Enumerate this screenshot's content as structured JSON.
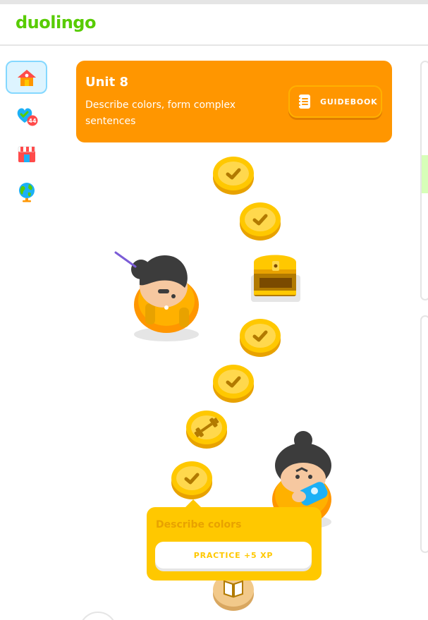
{
  "app": {
    "logo_text": "duolingo"
  },
  "sidebar": {
    "items": [
      {
        "name": "learn",
        "icon": "home-icon",
        "active": true
      },
      {
        "name": "practice",
        "icon": "practice-hub-icon",
        "badge": "44"
      },
      {
        "name": "shop",
        "icon": "shop-icon"
      },
      {
        "name": "profile",
        "icon": "globe-icon"
      }
    ]
  },
  "unit": {
    "title": "Unit 8",
    "description": "Describe colors, form complex sentences",
    "guidebook_label": "GUIDEBOOK",
    "color": "#ff9600"
  },
  "path": {
    "nodes": [
      {
        "type": "completed-lesson",
        "icon": "check-icon"
      },
      {
        "type": "completed-lesson",
        "icon": "check-icon"
      },
      {
        "type": "treasure-chest",
        "icon": "chest-icon"
      },
      {
        "type": "completed-lesson",
        "icon": "check-icon"
      },
      {
        "type": "completed-lesson",
        "icon": "check-icon"
      },
      {
        "type": "practice",
        "icon": "dumbbell-icon"
      },
      {
        "type": "completed-lesson",
        "icon": "check-icon",
        "selected": true
      },
      {
        "type": "story",
        "icon": "book-icon"
      }
    ]
  },
  "tooltip": {
    "title": "Describe colors",
    "button_label": "PRACTICE +5 XP"
  },
  "colors": {
    "gold": "#ffc800",
    "gold_dark": "#e8a200",
    "brand_green": "#58cc02"
  }
}
